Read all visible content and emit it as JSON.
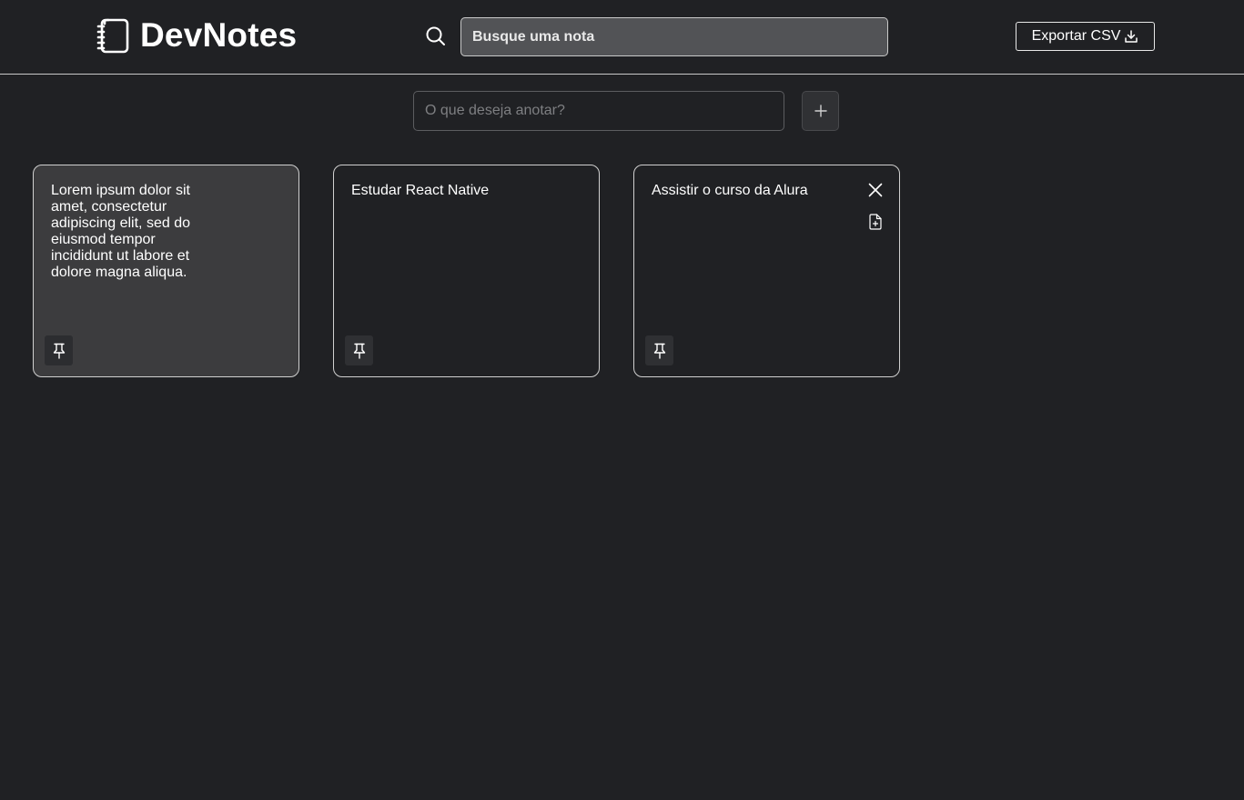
{
  "header": {
    "app_name": "DevNotes",
    "search": {
      "placeholder": "Busque uma nota",
      "value": ""
    },
    "export_label": "Exportar CSV"
  },
  "composer": {
    "placeholder": "O que deseja anotar?",
    "add_icon": "plus-icon"
  },
  "notes": [
    {
      "text": "Lorem ipsum dolor sit amet, consectetur adipiscing elit, sed do eiusmod tempor incididunt ut labore et dolore magna aliqua.",
      "active": true,
      "pin_icon": "pin-icon"
    },
    {
      "text": "Estudar React Native",
      "active": false,
      "pin_icon": "pin-icon"
    },
    {
      "text": "Assistir o curso da Alura",
      "active": false,
      "pin_icon": "pin-icon",
      "hover_actions": [
        "close-icon",
        "file-plus-icon"
      ]
    }
  ],
  "colors": {
    "background": "#202124",
    "active_card": "#3c3c3e",
    "search_field": "#525356",
    "text": "#ffffff"
  }
}
